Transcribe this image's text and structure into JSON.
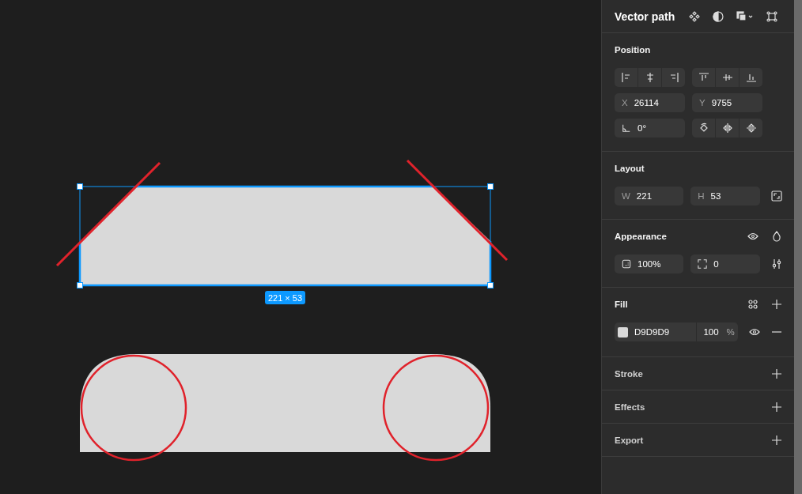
{
  "canvas": {
    "selection_label": "221 × 53"
  },
  "panel": {
    "title": "Vector path",
    "position": {
      "heading": "Position",
      "x": {
        "label": "X",
        "value": "26114"
      },
      "y": {
        "label": "Y",
        "value": "9755"
      },
      "rotation": "0°"
    },
    "layout": {
      "heading": "Layout",
      "w": {
        "label": "W",
        "value": "221"
      },
      "h": {
        "label": "H",
        "value": "53"
      }
    },
    "appearance": {
      "heading": "Appearance",
      "opacity": "100%",
      "radius": "0"
    },
    "fill": {
      "heading": "Fill",
      "fills": [
        {
          "hex": "D9D9D9",
          "color": "#d9d9d9",
          "opacity": "100",
          "unit": "%"
        }
      ]
    },
    "collapsed_sections": [
      {
        "heading": "Stroke"
      },
      {
        "heading": "Effects"
      },
      {
        "heading": "Export"
      }
    ]
  }
}
